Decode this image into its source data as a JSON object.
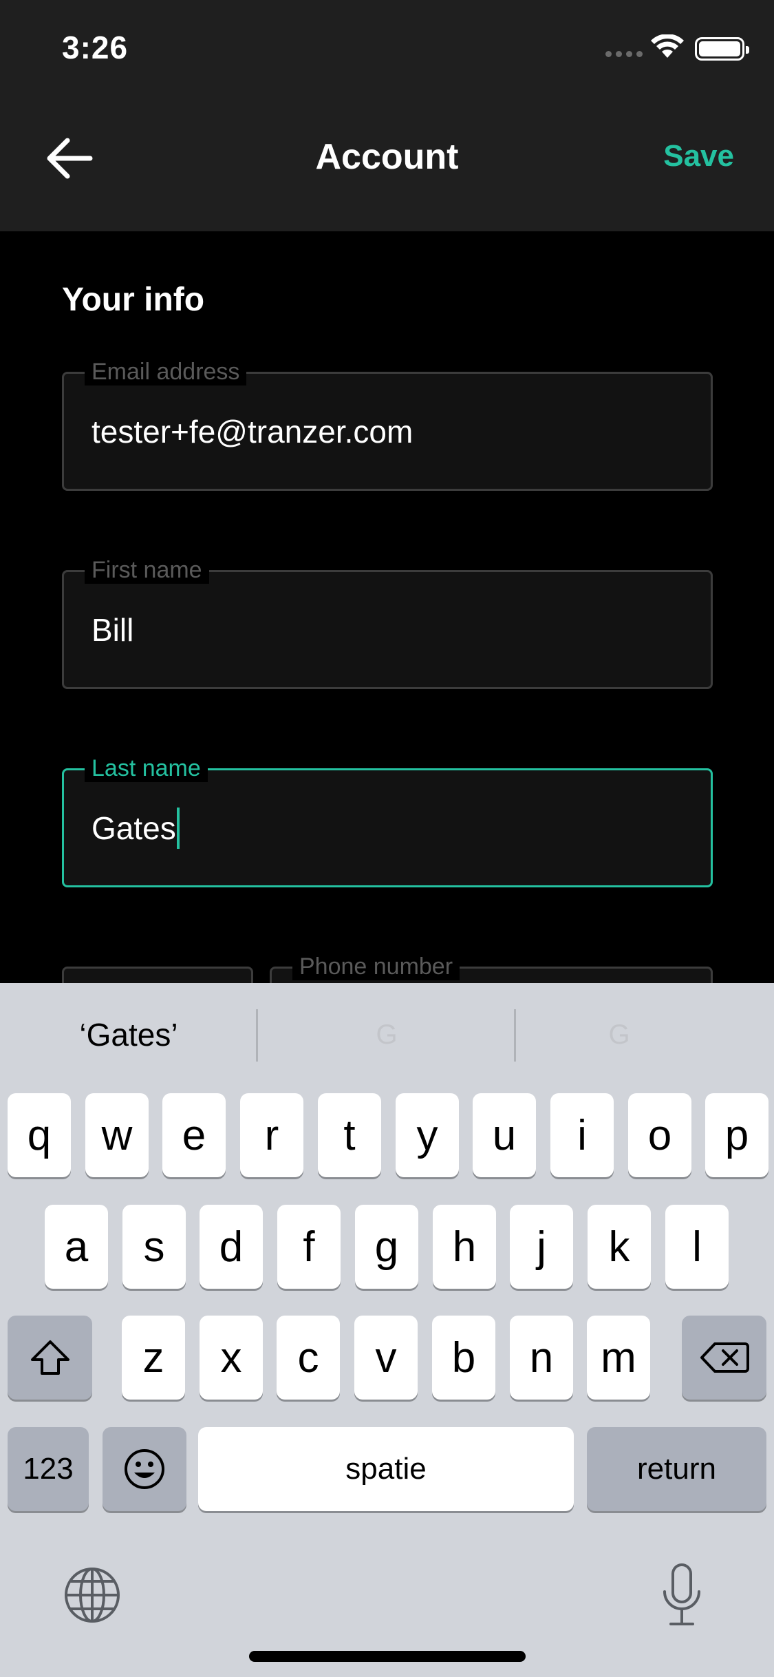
{
  "status_bar": {
    "time": "3:26"
  },
  "nav": {
    "title": "Account",
    "save_label": "Save"
  },
  "section": {
    "title": "Your info"
  },
  "fields": {
    "email": {
      "label": "Email address",
      "value": "tester+fe@tranzer.com"
    },
    "first_name": {
      "label": "First name",
      "value": "Bill"
    },
    "last_name": {
      "label": "Last name",
      "value": "Gates"
    },
    "phone": {
      "label": "Phone number"
    }
  },
  "keyboard": {
    "suggestions": [
      "‘Gates’",
      "G",
      "G"
    ],
    "row1": [
      "q",
      "w",
      "e",
      "r",
      "t",
      "y",
      "u",
      "i",
      "o",
      "p"
    ],
    "row2": [
      "a",
      "s",
      "d",
      "f",
      "g",
      "h",
      "j",
      "k",
      "l"
    ],
    "row3": [
      "z",
      "x",
      "c",
      "v",
      "b",
      "n",
      "m"
    ],
    "numbers_label": "123",
    "space_label": "spatie",
    "return_label": "return"
  },
  "colors": {
    "accent": "#24c1a0",
    "header_bg": "#1f1f1f",
    "keyboard_bg": "#d1d4da"
  }
}
